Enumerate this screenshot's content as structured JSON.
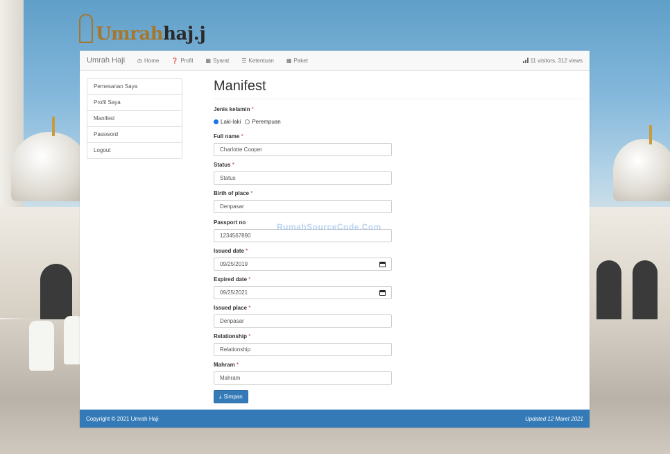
{
  "logo": {
    "part1": "Umrah",
    "part2": "haj.j"
  },
  "navbar": {
    "brand": "Umrah Haji",
    "items": [
      {
        "icon": "clock-icon",
        "glyph": "◷",
        "label": "Home"
      },
      {
        "icon": "question-circle-icon",
        "glyph": "❓",
        "label": "Profil"
      },
      {
        "icon": "grid-icon",
        "glyph": "▦",
        "label": "Syarat"
      },
      {
        "icon": "list-icon",
        "glyph": "☰",
        "label": "Ketentuan"
      },
      {
        "icon": "tiles-icon",
        "glyph": "▦",
        "label": "Paket"
      }
    ],
    "stats": "11 visitors, 312 views"
  },
  "sidebar": {
    "items": [
      {
        "label": "Pemesanan Saya"
      },
      {
        "label": "Profil Saya"
      },
      {
        "label": "Manifest"
      },
      {
        "label": "Password"
      },
      {
        "label": "Logout"
      }
    ]
  },
  "page": {
    "title": "Manifest"
  },
  "form": {
    "gender": {
      "label": "Jenis kelamin",
      "options": [
        "Laki-laki",
        "Perempuan"
      ],
      "selected": "Laki-laki"
    },
    "full_name": {
      "label": "Full name",
      "value": "Charlotte Cooper"
    },
    "status": {
      "label": "Status",
      "placeholder": "Status"
    },
    "birth_place": {
      "label": "Birth of place",
      "value": "Denpasar"
    },
    "passport": {
      "label": "Passport no",
      "value": "1234567890"
    },
    "issued_date": {
      "label": "Issued date",
      "value": "09/25/2019"
    },
    "expired_date": {
      "label": "Expired date",
      "value": "09/25/2021"
    },
    "issued_place": {
      "label": "Issued place",
      "value": "Denpasar"
    },
    "relationship": {
      "label": "Relationship",
      "placeholder": "Relationship"
    },
    "mahram": {
      "label": "Mahram",
      "placeholder": "Mahram"
    },
    "required_mark": "*",
    "save_label": "Simpan"
  },
  "watermark": "RumahSourceCode.Com",
  "footer": {
    "left": "Copyright © 2021 Umrah Haji",
    "right": "Updated 12 Maret 2021"
  },
  "colors": {
    "primary": "#337ab7",
    "logo_gold": "#a8762b",
    "required": "#a94442"
  }
}
